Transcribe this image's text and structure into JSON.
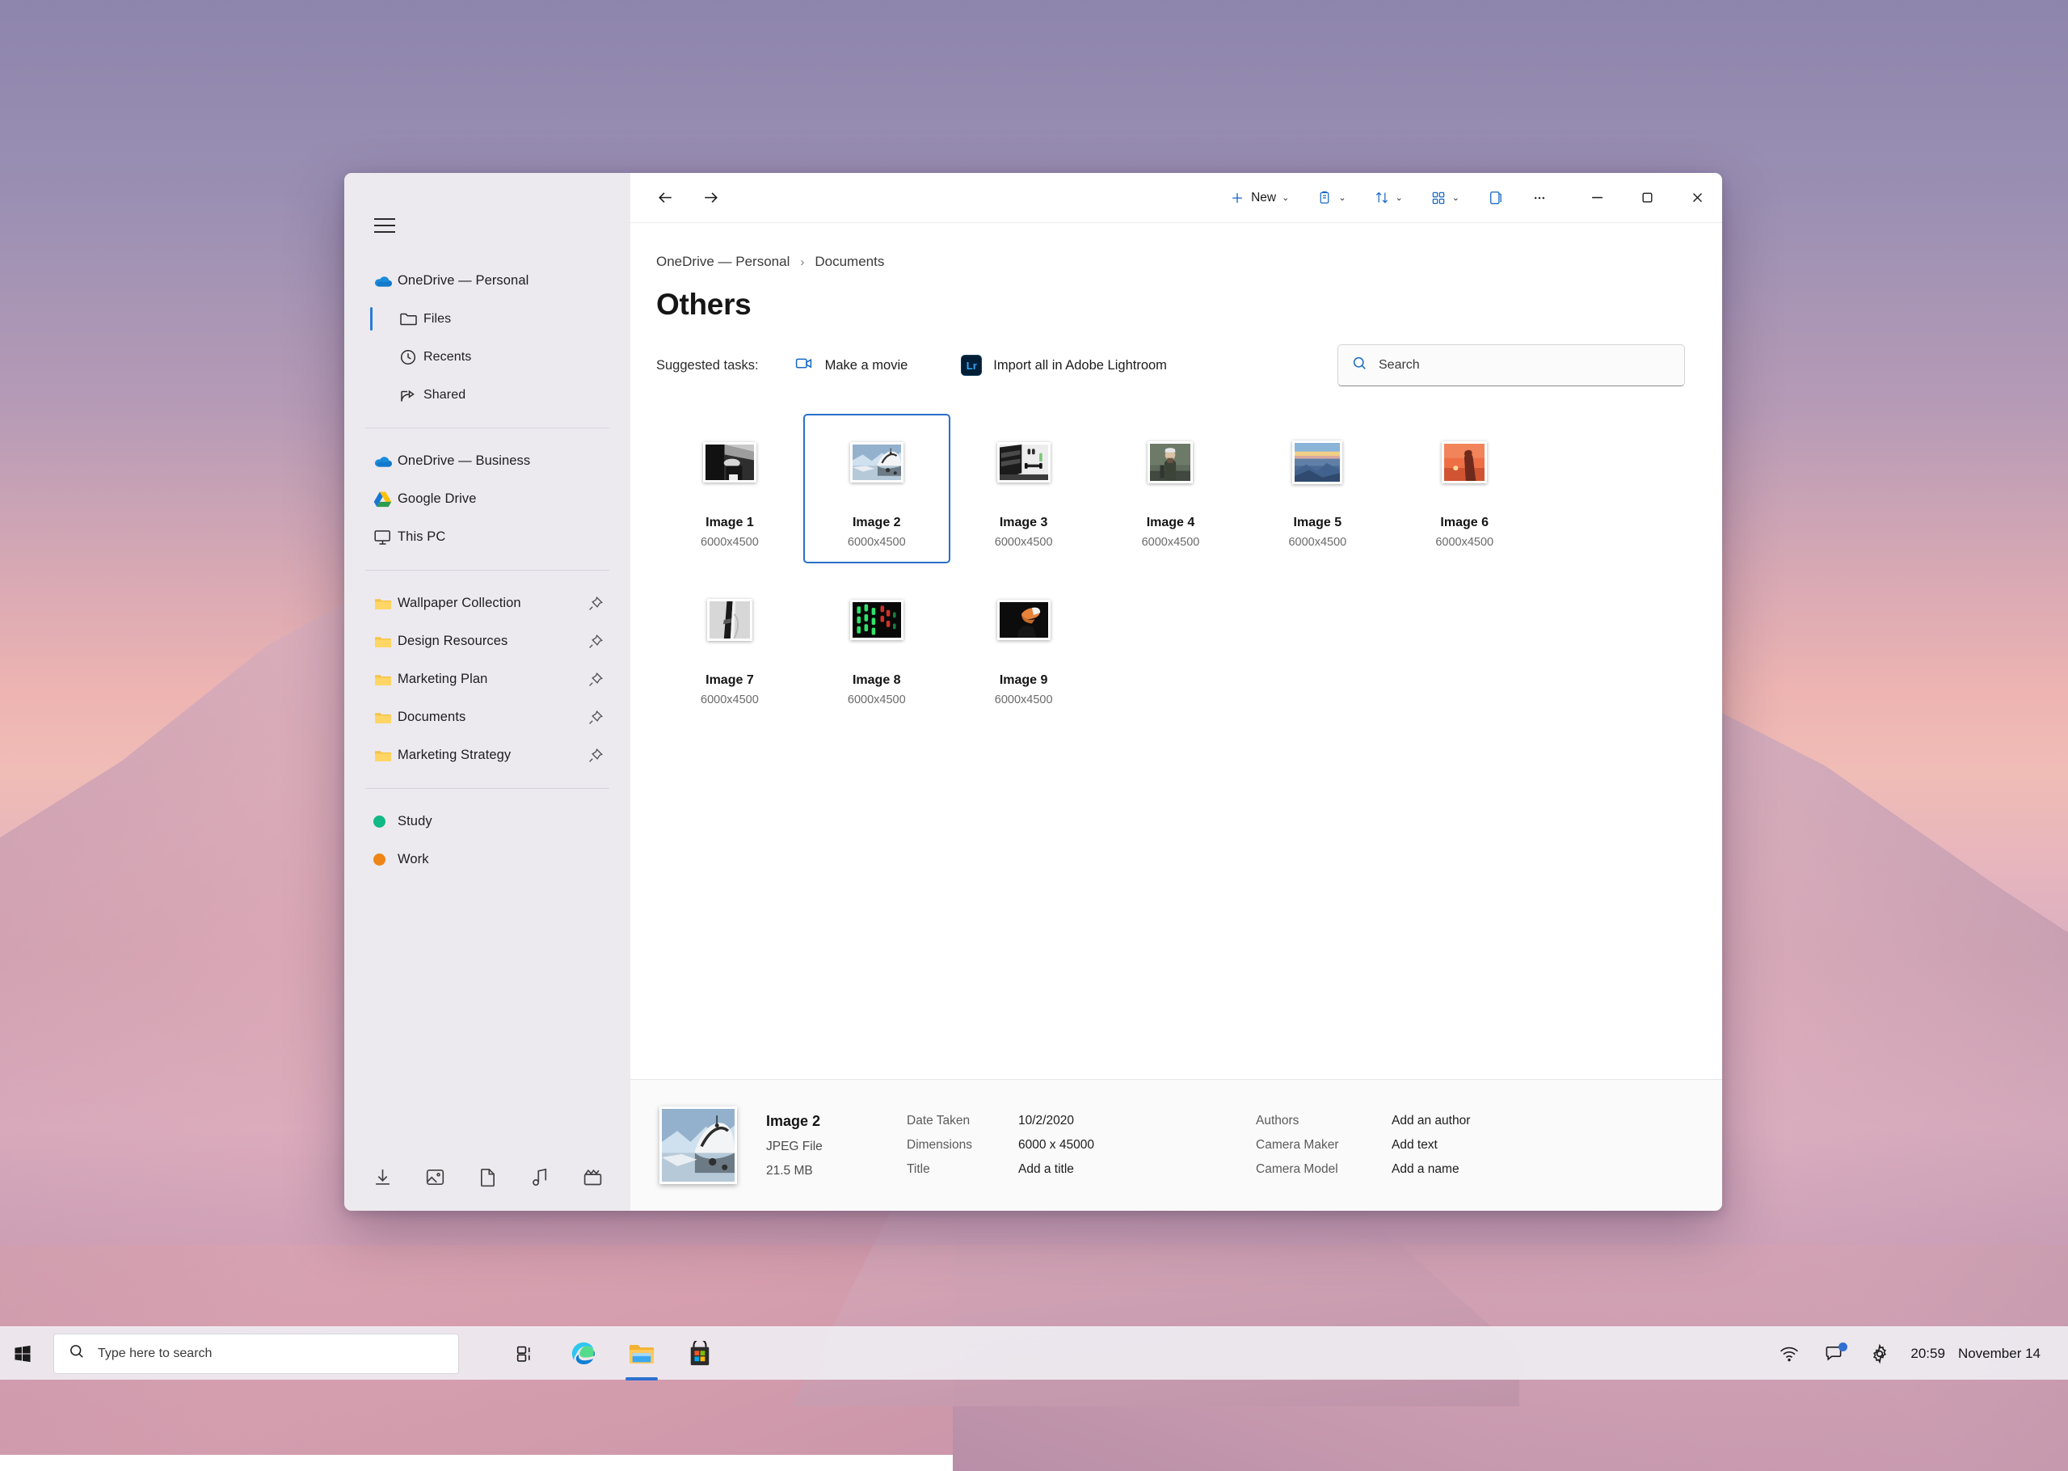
{
  "desktop": {
    "wallpaper_desc": "snow-mountain-sunset"
  },
  "window": {
    "titlebar": {
      "back_icon": "arrow-left-icon",
      "forward_icon": "arrow-right-icon",
      "new_label": "New",
      "new_icon": "plus-icon",
      "paste_icon": "clipboard-icon",
      "sort_icon": "sort-icon",
      "view_icon": "view-grid-icon",
      "details_pane_icon": "details-pane-icon",
      "more_icon": "ellipsis-icon",
      "minimize_icon": "minimize-icon",
      "maximize_icon": "maximize-icon",
      "close_icon": "close-icon"
    },
    "breadcrumb": {
      "root": "OneDrive — Personal",
      "separator": "›",
      "current": "Documents"
    },
    "page_title": "Others",
    "suggested": {
      "label": "Suggested tasks:",
      "tasks": [
        {
          "label": "Make a movie",
          "icon": "video-camera-icon"
        },
        {
          "label": "Import all in Adobe Lightroom",
          "icon": "lightroom-icon",
          "badge": "Lr"
        }
      ]
    },
    "search": {
      "placeholder": "Search",
      "value": "",
      "icon": "search-icon"
    },
    "items": [
      {
        "name": "Image 1",
        "dimensions": "6000x4500",
        "selected": false,
        "thumb": "bw-street-crowd"
      },
      {
        "name": "Image 2",
        "dimensions": "6000x4500",
        "selected": true,
        "thumb": "snow-mountain-lake"
      },
      {
        "name": "Image 3",
        "dimensions": "6000x4500",
        "selected": false,
        "thumb": "gym-dumbbells"
      },
      {
        "name": "Image 4",
        "dimensions": "6000x4500",
        "selected": false,
        "thumb": "person-beanie-wall"
      },
      {
        "name": "Image 5",
        "dimensions": "6000x4500",
        "selected": false,
        "thumb": "sunset-sea-horizon"
      },
      {
        "name": "Image 6",
        "dimensions": "6000x4500",
        "selected": false,
        "thumb": "orange-sunset-figure"
      },
      {
        "name": "Image 7",
        "dimensions": "6000x4500",
        "selected": false,
        "thumb": "bw-tower-minimal"
      },
      {
        "name": "Image 8",
        "dimensions": "6000x4500",
        "selected": false,
        "thumb": "green-neon-lights"
      },
      {
        "name": "Image 9",
        "dimensions": "6000x4500",
        "selected": false,
        "thumb": "dark-orange-shoe"
      }
    ],
    "details": {
      "name": "Image 2",
      "type": "JPEG File",
      "size": "21.5 MB",
      "fields_mid": [
        {
          "key": "Date Taken",
          "value": "10/2/2020"
        },
        {
          "key": "Dimensions",
          "value": "6000 x 45000"
        },
        {
          "key": "Title",
          "value": "Add a title"
        }
      ],
      "fields_right": [
        {
          "key": "Authors",
          "value": "Add an author"
        },
        {
          "key": "Camera Maker",
          "value": "Add text"
        },
        {
          "key": "Camera Model",
          "value": "Add a name"
        }
      ]
    }
  },
  "sidebar": {
    "menu_icon": "hamburger-icon",
    "groups": [
      {
        "items": [
          {
            "label": "OneDrive — Personal",
            "icon": "onedrive-cloud-icon",
            "type": "cloud",
            "selected": false
          },
          {
            "label": "Files",
            "icon": "folder-outline-icon",
            "type": "child",
            "selected": true
          },
          {
            "label": "Recents",
            "icon": "clock-icon",
            "type": "child",
            "selected": false
          },
          {
            "label": "Shared",
            "icon": "share-icon",
            "type": "child",
            "selected": false
          }
        ]
      },
      {
        "items": [
          {
            "label": "OneDrive — Business",
            "icon": "onedrive-cloud-icon",
            "type": "cloud"
          },
          {
            "label": "Google Drive",
            "icon": "google-drive-icon",
            "type": "gdrive"
          },
          {
            "label": "This PC",
            "icon": "monitor-icon",
            "type": "pc"
          }
        ]
      },
      {
        "items": [
          {
            "label": "Wallpaper Collection",
            "icon": "folder-icon",
            "type": "folder",
            "pin": "pin-icon"
          },
          {
            "label": "Design Resources",
            "icon": "folder-icon",
            "type": "folder",
            "pin": "pin-icon"
          },
          {
            "label": "Marketing Plan",
            "icon": "folder-icon",
            "type": "folder",
            "pin": "pin-icon"
          },
          {
            "label": "Documents",
            "icon": "folder-icon",
            "type": "folder",
            "pin": "pin-icon"
          },
          {
            "label": "Marketing Strategy",
            "icon": "folder-icon",
            "type": "folder",
            "pin": "pin-icon"
          }
        ]
      },
      {
        "items": [
          {
            "label": "Study",
            "icon": "color-dot-icon",
            "type": "tag",
            "color": "#12b886"
          },
          {
            "label": "Work",
            "icon": "color-dot-icon",
            "type": "tag",
            "color": "#ef8516"
          }
        ]
      }
    ],
    "quick_icons": [
      {
        "name": "download-icon"
      },
      {
        "name": "pictures-icon"
      },
      {
        "name": "documents-icon"
      },
      {
        "name": "music-icon"
      },
      {
        "name": "videos-icon"
      }
    ]
  },
  "taskbar": {
    "start_icon": "windows-start-icon",
    "search": {
      "placeholder": "Type here to search",
      "value": "",
      "icon": "search-icon"
    },
    "apps": [
      {
        "name": "task-view-icon",
        "active": false
      },
      {
        "name": "microsoft-edge-icon",
        "active": false
      },
      {
        "name": "file-explorer-icon",
        "active": true
      },
      {
        "name": "microsoft-store-icon",
        "active": false
      }
    ],
    "tray": [
      {
        "name": "wifi-icon"
      },
      {
        "name": "chat-icon",
        "badge": true
      },
      {
        "name": "settings-gear-icon"
      }
    ],
    "clock": {
      "time": "20:59",
      "date": "November 14"
    }
  },
  "colors": {
    "accent": "#2a6fc9",
    "toolbar_blue": "#1668c4",
    "sidebar_bg": "#eceaef",
    "content_bg": "#ffffff",
    "details_bg": "#fafafa",
    "folder_yellow": "#f6c344",
    "study_green": "#12b886",
    "work_orange": "#ef8516"
  }
}
